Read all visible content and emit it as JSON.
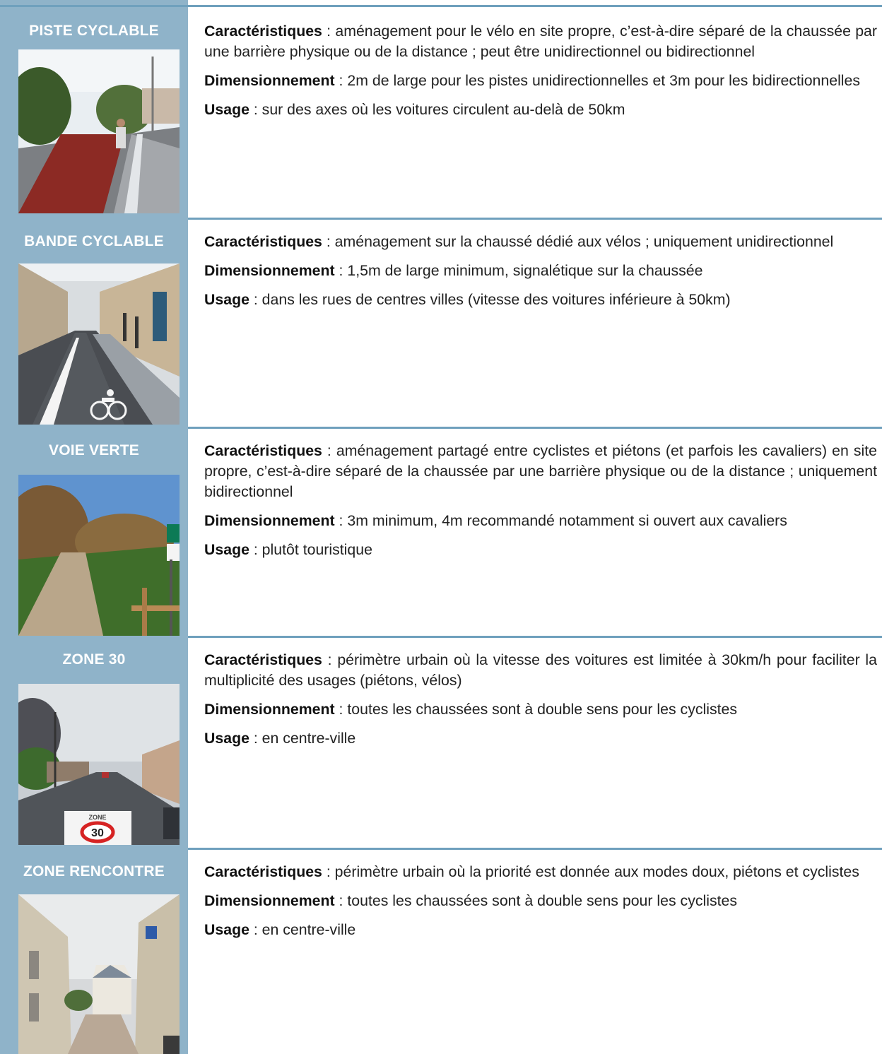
{
  "rows": [
    {
      "title": "PISTE CYCLABLE",
      "car_label": "Caractéristiques",
      "car_text": " : aménagement pour le vélo en site propre, c’est-à-dire séparé de la chaussée par une barrière physique ou de la distance ; peut être unidirectionnel ou bidirectionnel",
      "dim_label": "Dimensionnement",
      "dim_text": " : 2m de large pour les pistes unidirectionnelles et 3m pour les bidirectionnelles",
      "use_label": "Usage",
      "use_text": " : sur des axes où les voitures circulent au-delà de 50km"
    },
    {
      "title": "BANDE CYCLABLE",
      "car_label": "Caractéristiques",
      "car_text": " : aménagement sur la chaussé dédié aux vélos ; uniquement unidirectionnel",
      "dim_label": "Dimensionnement",
      "dim_text": " : 1,5m de large minimum, signalétique sur la chaussée",
      "use_label": "Usage",
      "use_text": " : dans les rues de centres villes (vitesse des voitures inférieure à 50km)"
    },
    {
      "title": "VOIE VERTE",
      "car_label": "Caractéristiques",
      "car_text": " : aménagement partagé entre cyclistes et piétons (et parfois les cavaliers) en site propre, c’est-à-dire séparé de la chaussée par une barrière physique ou de la distance ; uniquement bidirectionnel",
      "dim_label": "Dimensionnement",
      "dim_text": " : 3m minimum, 4m recommandé notamment si ouvert aux cavaliers",
      "use_label": "Usage",
      "use_text": " : plutôt touristique"
    },
    {
      "title": "ZONE 30",
      "car_label": "Caractéristiques",
      "car_text": " : périmètre urbain où la vitesse des voitures est limitée à 30km/h pour faciliter la multiplicité des usages (piétons, vélos)",
      "dim_label": "Dimensionnement",
      "dim_text": " : toutes les chaussées sont à double sens pour les cyclistes",
      "use_label": "Usage",
      "use_text": " : en centre-ville"
    },
    {
      "title": "ZONE RENCONTRE",
      "car_label": "Caractéristiques",
      "car_text": " : périmètre urbain où la priorité est donnée aux modes doux, piétons et cyclistes",
      "dim_label": "Dimensionnement",
      "dim_text": " : toutes les chaussées sont à double sens pour les cyclistes",
      "use_label": "Usage",
      "use_text": " : en centre-ville"
    }
  ],
  "photo_labels": {
    "zone30_marking_word": "ZONE",
    "zone30_marking_number": "30"
  },
  "colors": {
    "sidebar": "#8fb3c9",
    "rule": "#6fa0bd",
    "title_text": "#ffffff"
  }
}
